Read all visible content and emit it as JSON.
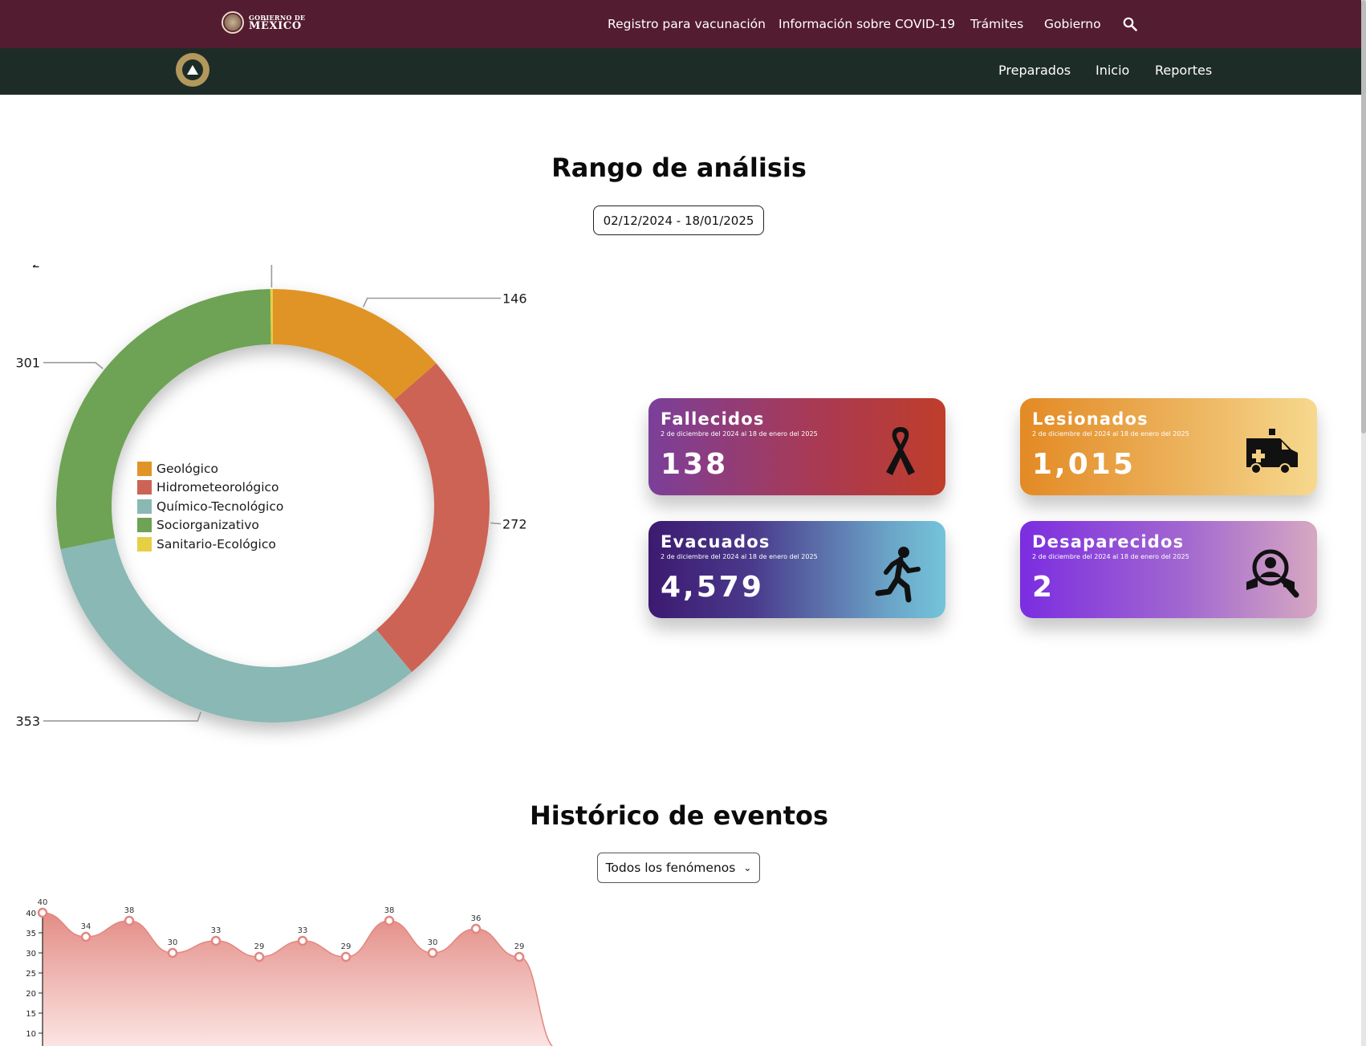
{
  "gov_bar": {
    "logo_top": "GOBIERNO DE",
    "logo_bottom": "MÉXICO",
    "links": [
      "Registro para vacunación",
      "Información sobre COVID-19",
      "Trámites",
      "Gobierno"
    ]
  },
  "sub_bar": {
    "links": [
      "Preparados",
      "Inicio",
      "Reportes"
    ]
  },
  "analysis": {
    "title": "Rango de análisis",
    "range": "02/12/2024 - 18/01/2025"
  },
  "chart_data": [
    {
      "type": "pie",
      "variant": "donut",
      "categories": [
        "Geológico",
        "Hidrometeorológico",
        "Químico-Tecnológico",
        "Sociorganizativo",
        "Sanitario-Ecológico"
      ],
      "values": [
        146,
        272,
        353,
        301,
        2
      ],
      "colors": [
        "#e09428",
        "#cc6455",
        "#8ab8b4",
        "#6ea255",
        "#e6cf45"
      ],
      "legend": "inside-center-left"
    },
    {
      "type": "area",
      "x": [
        1,
        2,
        3,
        4,
        5,
        6,
        7,
        8,
        9,
        10,
        11,
        12
      ],
      "values": [
        40,
        34,
        38,
        30,
        33,
        29,
        33,
        29,
        38,
        30,
        36,
        29
      ],
      "yticks": [
        10,
        15,
        20,
        25,
        30,
        35,
        40
      ],
      "color": "#e2867f"
    }
  ],
  "cards": [
    {
      "name": "Fallecidos",
      "sub": "2 de diciembre del 2024 al 18 de enero del 2025",
      "value": "138",
      "icon": "ribbon-icon"
    },
    {
      "name": "Lesionados",
      "sub": "2 de diciembre del 2024 al 18 de enero del 2025",
      "value": "1,015",
      "icon": "ambulance-icon"
    },
    {
      "name": "Evacuados",
      "sub": "2 de diciembre del 2024 al 18 de enero del 2025",
      "value": "4,579",
      "icon": "running-person-icon"
    },
    {
      "name": "Desaparecidos",
      "sub": "2 de diciembre del 2024 al 18 de enero del 2025",
      "value": "2",
      "icon": "person-search-icon"
    }
  ],
  "history": {
    "title": "Histórico de eventos",
    "selected": "Todos los fenómenos"
  }
}
